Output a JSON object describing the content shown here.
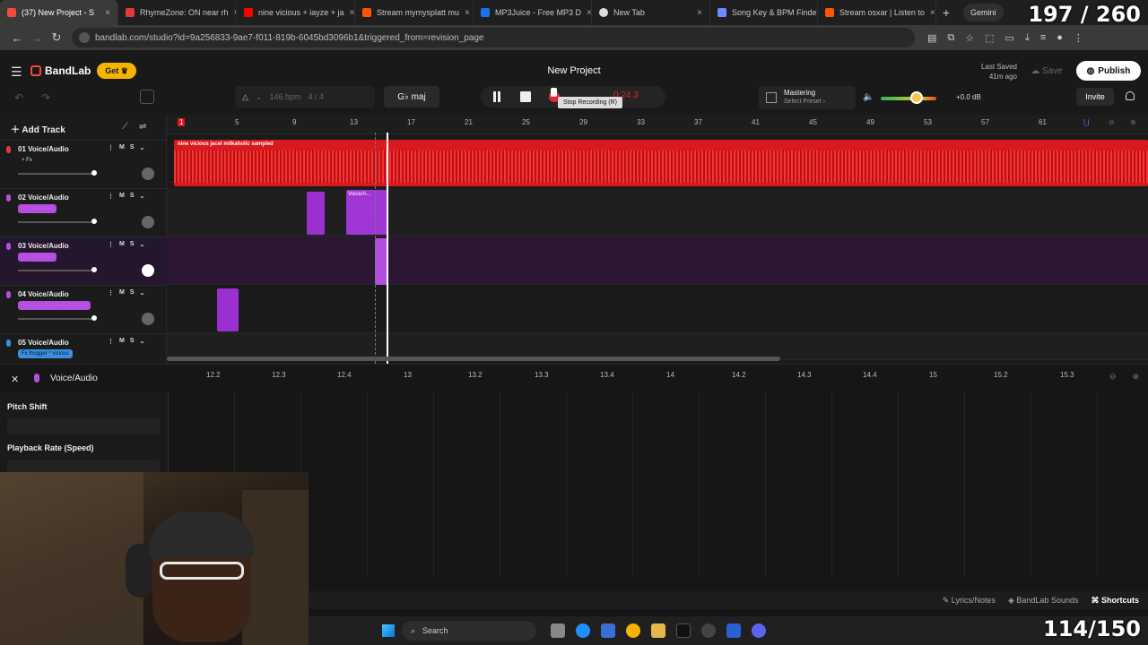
{
  "browser": {
    "tabs": [
      {
        "label": "(37) New Project - S",
        "favicon_color": "#f24a3a",
        "active": true
      },
      {
        "label": "RhymeZone: ON near rh",
        "favicon_color": "#e23a3a"
      },
      {
        "label": "nine vicious + iayze + ja",
        "favicon_color": "#ff0000"
      },
      {
        "label": "Stream mymysplatt mu",
        "favicon_color": "#ff5500"
      },
      {
        "label": "MP3Juice - Free MP3 D",
        "favicon_color": "#1a73e8"
      },
      {
        "label": "New Tab",
        "favicon_color": "#dddddd"
      },
      {
        "label": "Song Key & BPM Finde",
        "favicon_color": "#6b8cff"
      },
      {
        "label": "Stream osxar | Listen to",
        "favicon_color": "#ff5500"
      }
    ],
    "gemini_label": "Gemini",
    "url": "bandlab.com/studio?id=9a256833-9ae7-f011-819b-6045bd3096b1&triggered_from=revision_page"
  },
  "header": {
    "brand": "BandLab",
    "get_label": "Get",
    "project_title": "New Project",
    "last_saved_label": "Last Saved",
    "last_saved_time": "41m ago",
    "save_label": "Save",
    "publish_label": "Publish",
    "bpm": "146 bpm",
    "time_sig": "4 / 4",
    "key": "G♭ maj",
    "time_readout": "0:24.3",
    "tooltip": "Stop Recording (R)",
    "mastering_label": "Mastering",
    "mastering_preset": "Select Preset",
    "volume_db": "+0.0 dB",
    "volume_level": 0.65,
    "invite_label": "Invite"
  },
  "tracks_panel": {
    "add_track_label": "Add Track",
    "tracks": [
      {
        "name": "01  Voice/Audio",
        "fx": "+ Fx",
        "fx_color": "#1b1b1b",
        "fx_text": "#ddd",
        "mic": "#e23a3a"
      },
      {
        "name": "02  Voice/Audio",
        "fx": "Fx insomniac",
        "fx_color": "#b44ee0",
        "fx_text": "#b44ee0",
        "mic": "#b44ee0"
      },
      {
        "name": "03  Voice/Audio",
        "fx": "Fx insomniac",
        "fx_color": "#b44ee0",
        "fx_text": "#b44ee0",
        "mic": "#b44ee0"
      },
      {
        "name": "04  Voice/Audio",
        "fx": "Fx Ad Lib Expanded Preset",
        "fx_color": "#b44ee0",
        "fx_text": "#b44ee0",
        "mic": "#b44ee0"
      },
      {
        "name": "05  Voice/Audio",
        "fx": "Fx thugger * vicious",
        "fx_color": "#3a8fe0",
        "fx_text": "#0a1b33",
        "mic": "#3a8fe0"
      }
    ],
    "mute_label": "M",
    "solo_label": "S"
  },
  "timeline": {
    "bars": [
      "1",
      "5",
      "9",
      "13",
      "17",
      "21",
      "25",
      "29",
      "33",
      "37",
      "41",
      "45",
      "49",
      "53",
      "57",
      "61"
    ],
    "region1_name": "nine vicious  jacel  milkaholic sampled",
    "clip2_name": "Voice/A..."
  },
  "editor": {
    "title": "Voice/Audio",
    "pitch_shift_label": "Pitch Shift",
    "playback_rate_label": "Playback Rate (Speed)",
    "ruler": [
      "12.2",
      "12.3",
      "12.4",
      "13",
      "13.2",
      "13.3",
      "13.4",
      "14",
      "14.2",
      "14.3",
      "14.4",
      "15",
      "15.2",
      "15.3"
    ]
  },
  "bottom_bar": {
    "lyrics_label": "Lyrics/Notes",
    "sounds_label": "BandLab Sounds",
    "shortcuts_label": "Shortcuts"
  },
  "taskbar": {
    "search_label": "Search"
  },
  "overlay": {
    "counter_top": "197 / 260",
    "counter_bottom": "114/150"
  },
  "colors": {
    "accent_red": "#d8191d",
    "accent_purple": "#9b30d0",
    "publish_bg": "#ffffff",
    "get_bg": "#f4b400"
  }
}
